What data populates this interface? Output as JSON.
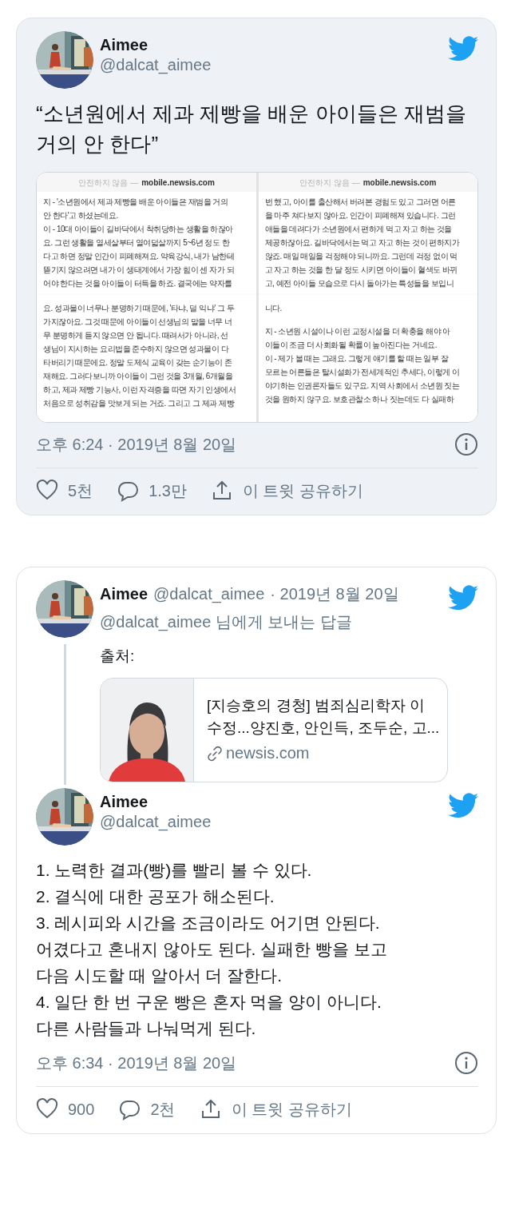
{
  "cards": [
    {
      "tweets": [
        {
          "kind": "focus",
          "name": "Aimee",
          "handle": "@dalcat_aimee",
          "text": [
            [
              "“소년원에서 제과 제빵을 배운 아이들은 재범을",
              "거의 안 한다”"
            ]
          ],
          "media": {
            "kind": "screenshot",
            "columns": [
              {
                "note": "안전하지 않음 —",
                "url": "mobile.newsis.com",
                "top": [
                  [
                    "지 - '소년원에서 제과 제빵을 배운 아이들은 재범을 거의",
                    "안 한다'고 하셨는데요.",
                    "이 - 10대 아이들이 길바닥에서 착취당하는 생활을 하잖아",
                    "요. 그런 생활을 열세살부터 열여덟살까지 5~6년 정도 한",
                    "다고 하면 정말 인간이 피폐해져요. 약육강식, 내가 남한테",
                    "뜯기지 않으려면 내가 이 생태계에서 가장 힘이 센 자가 되",
                    "어야 한다는 것을 아이들이 터득을 하죠. 결국에는 약자를"
                  ]
                ],
                "bottom": [
                  [
                    "요. 성과물이 너무나 분명하기 때문에, '타냐, 덜 익냐' 그 두",
                    "가지잖아요. 그것  때문에 아이들이 선생님의 말을 너무 너",
                    "무 분명하게 듣지 않으면 안 됩니다.  때려서가 아니라, 선",
                    "생님이 지시하는 요리법을 준수하지 않으면 성과물이 다",
                    "타버리기 때문에요. 정말 도제식 교육이 갖는 순기능이 존",
                    "재해요. 그러다보니까 아이들이 그런 것을 3개월, 6개월을",
                    "하고, 제과 제빵 기능사, 이런 자격증을 따면 자기 인생에서",
                    "처음으로 성취감을 맛보게 되는 거죠. 그리고 그 제과 제빵"
                  ]
                ]
              },
              {
                "note": "안전하지 않음 —",
                "url": "mobile.newsis.com",
                "top": [
                  [
                    "번 했고, 아이를 출산해서 버려본 경험도 있고 그러면 어른",
                    "을 마주 쳐다보지 않아요. 인간이 피폐해져 있습니다. 그런",
                    "애들을 데려다가 소년원에서 편하게 먹고 자고 하는 것을",
                    "제공하잖아요. 길바닥에서는 먹고 자고 하는 것이 편하지가",
                    "않죠. 매일 매일을 걱정해야 되니까요. 그런데 걱정 없이 먹",
                    "고 자고 하는 것을 한 달 정도 시키면 아이들이 혈색도 바뀌",
                    "고, 예전 아이들 모습으로 다시 돌아가는 특성들을 보입니"
                  ]
                ],
                "bottom": [
                  [
                    "니다."
                  ],
                  [
                    "지 - 소년원 시설이나 이런 교정시설을 더 확충을 해야 아",
                    "이들이 조금 더 사회화될 확률이 높아진다는 거네요.",
                    "이 - 제가 볼 때는 그래요. 그렇게 얘기를 할 때는 일부 잘",
                    "모르는 어른들은 탈시설화가 전세계적인 추세다, 이렇게 이",
                    "야기하는 인권론자들도 있구요. 지역 사회에서 소년원 짓는",
                    "것을 원하지 않구요. 보호관찰소 하나 짓는데도 다 실패하"
                  ]
                ]
              }
            ]
          },
          "timestamp": "오후 6:24 · 2019년 8월 20일",
          "likes": "5천",
          "replies": "1.3만",
          "share": "이 트윗 공유하기"
        }
      ]
    },
    {
      "tweets": [
        {
          "kind": "reply",
          "name": "Aimee",
          "handle": "@dalcat_aimee",
          "date": "· 2019년 8월 20일",
          "reply_to": "@dalcat_aimee 님에게 보내는 답글",
          "text": [
            [
              "출처:"
            ]
          ],
          "link_card": {
            "title": [
              "[지승호의 경청] 범죄심리학자 이",
              "수정...양진호, 안인득, 조두순, 고..."
            ],
            "domain": "newsis.com"
          }
        },
        {
          "kind": "focus",
          "name": "Aimee",
          "handle": "@dalcat_aimee",
          "text": [
            [
              "1. 노력한 결과(빵)를 빨리 볼 수 있다."
            ],
            [
              "2. 결식에 대한 공포가 해소된다."
            ],
            [
              "3. 레시피와 시간을 조금이라도 어기면 안된다.",
              "어겼다고 혼내지 않아도 된다. 실패한 빵을 보고",
              "다음 시도할 때 알아서 더 잘한다."
            ],
            [
              "4. 일단 한 번 구운 빵은 혼자 먹을 양이 아니다.",
              "다른 사람들과 나눠먹게 된다."
            ]
          ],
          "timestamp": "오후 6:34 · 2019년 8월 20일",
          "likes": "900",
          "replies": "2천",
          "share": "이 트윗 공유하기"
        }
      ]
    }
  ]
}
